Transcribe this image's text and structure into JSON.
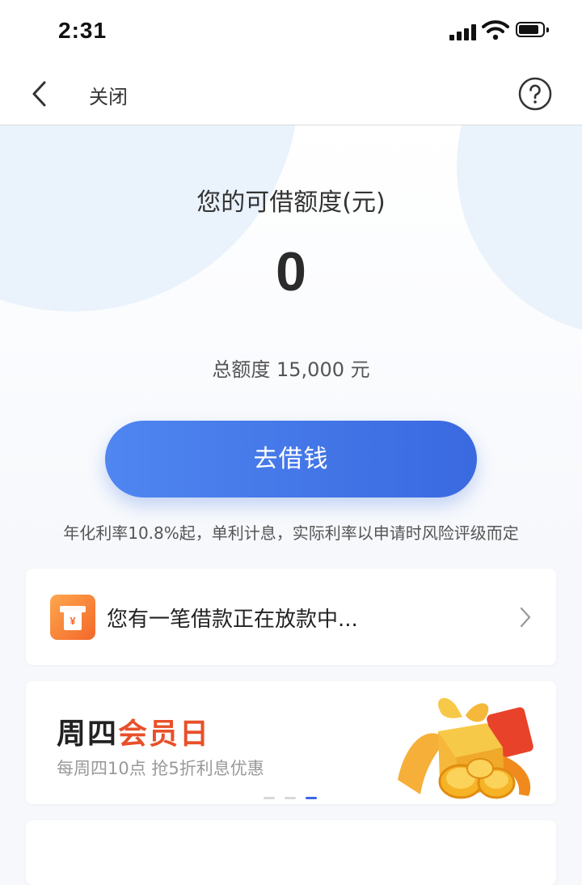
{
  "status_bar": {
    "time": "2:31"
  },
  "nav": {
    "close_label": "关闭"
  },
  "credit": {
    "label": "您的可借额度(元)",
    "value": "0",
    "total_text": "总额度 15,000 元"
  },
  "borrow_button": {
    "label": "去借钱"
  },
  "rate_note": "年化利率10.8%起，单利计息，实际利率以申请时风险评级而定",
  "loan_status": {
    "text": "您有一笔借款正在放款中...",
    "icon_symbol": "¥"
  },
  "promo": {
    "title_part1": "周四",
    "title_part2": "会员日",
    "subtitle": "每周四10点 抢5折利息优惠",
    "slide_count": 3,
    "active_slide": 3
  },
  "colors": {
    "accent_blue": "#3a69e0",
    "promo_highlight": "#e8502a",
    "loan_icon": "#f2682a"
  }
}
